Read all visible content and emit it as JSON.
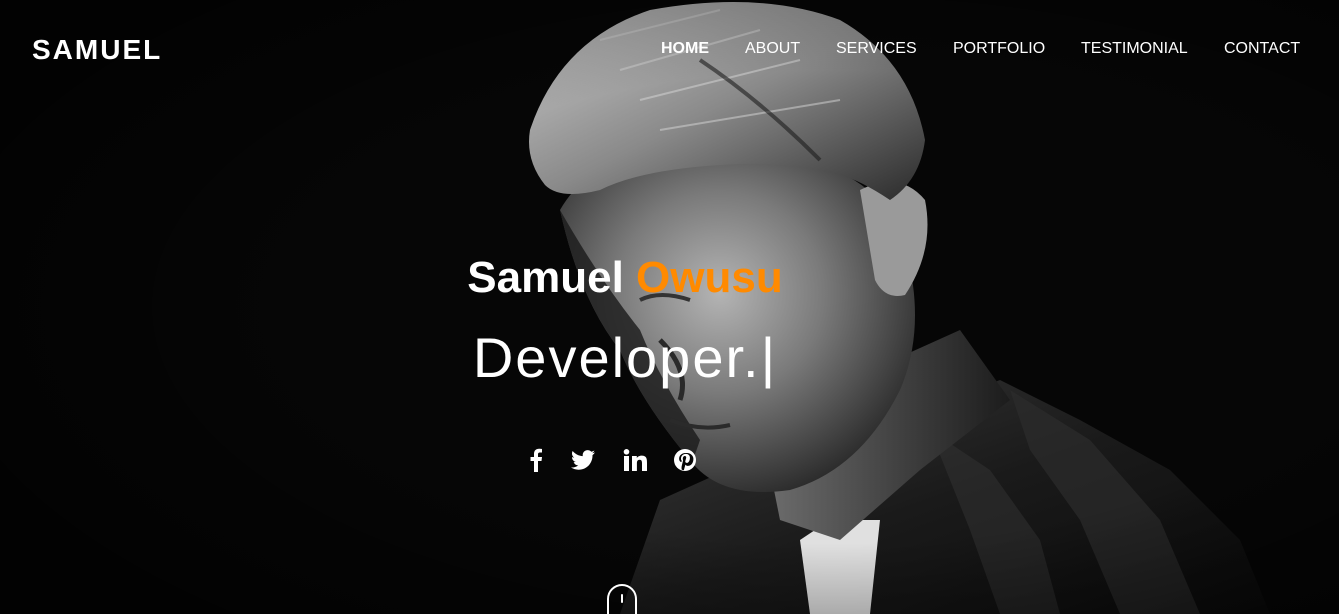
{
  "brand": "SAMUEL",
  "nav": {
    "home": "HOME",
    "about": "ABOUT",
    "services": "SERVICES",
    "portfolio": "PORTFOLIO",
    "testimonial": "TESTIMONIAL",
    "contact": "CONTACT"
  },
  "hero": {
    "first_name": "Samuel",
    "last_name": "Owusu",
    "role_text": "Developer.",
    "cursor": "|"
  },
  "social": [
    "facebook-icon",
    "twitter-icon",
    "linkedin-icon",
    "pinterest-icon"
  ],
  "colors": {
    "accent": "#ff8a00",
    "background": "#060606",
    "text": "#ffffff"
  }
}
